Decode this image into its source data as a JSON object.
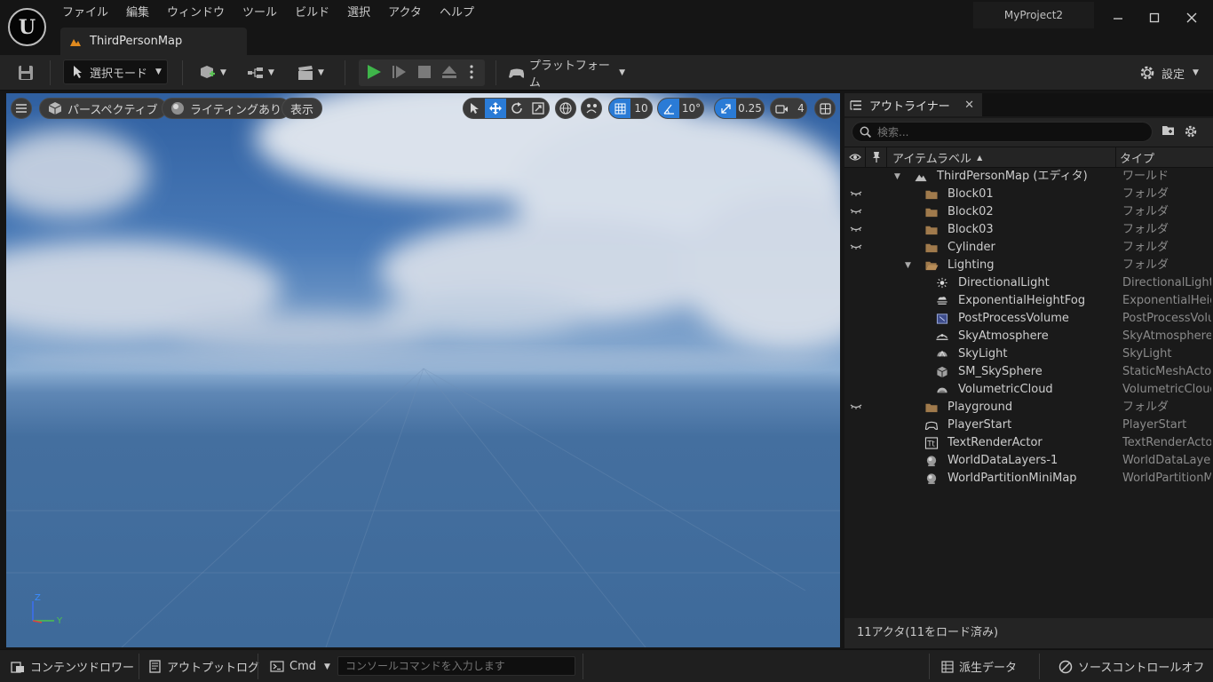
{
  "menu": {
    "items": [
      "ファイル",
      "編集",
      "ウィンドウ",
      "ツール",
      "ビルド",
      "選択",
      "アクタ",
      "ヘルプ"
    ]
  },
  "title_bar": {
    "document_tab": "ThirdPersonMap",
    "project_name": "MyProject2",
    "logo_letter": "U"
  },
  "toolbar": {
    "mode_label": "選択モード",
    "platform_label": "プラットフォーム",
    "settings_label": "設定"
  },
  "viewport": {
    "perspective_label": "パースペクティブ",
    "lighting_label": "ライティングあり",
    "show_label": "表示",
    "grid_snap_value": "10",
    "rotation_snap_value": "10°",
    "scale_snap_value": "0.25",
    "camera_speed_value": "4",
    "axis_z": "Z",
    "axis_y": "Y"
  },
  "outliner": {
    "tab_label": "アウトライナー",
    "search_placeholder": "検索...",
    "col_item_label": "アイテムラベル",
    "col_type": "タイプ",
    "status": "11アクタ(11をロード済み)",
    "rows": [
      {
        "label": "ThirdPersonMap (エディタ)",
        "type": "ワールド",
        "icon": "world-icon"
      },
      {
        "label": "Block01",
        "type": "フォルダ",
        "icon": "folder-icon"
      },
      {
        "label": "Block02",
        "type": "フォルダ",
        "icon": "folder-icon"
      },
      {
        "label": "Block03",
        "type": "フォルダ",
        "icon": "folder-icon"
      },
      {
        "label": "Cylinder",
        "type": "フォルダ",
        "icon": "folder-icon"
      },
      {
        "label": "Lighting",
        "type": "フォルダ",
        "icon": "folder-open-icon"
      },
      {
        "label": "DirectionalLight",
        "type": "DirectionalLight",
        "icon": "directional-light-icon"
      },
      {
        "label": "ExponentialHeightFog",
        "type": "ExponentialHeightFog",
        "icon": "fog-icon"
      },
      {
        "label": "PostProcessVolume",
        "type": "PostProcessVolume",
        "icon": "post-process-icon"
      },
      {
        "label": "SkyAtmosphere",
        "type": "SkyAtmosphere",
        "icon": "sky-atmosphere-icon"
      },
      {
        "label": "SkyLight",
        "type": "SkyLight",
        "icon": "sky-light-icon"
      },
      {
        "label": "SM_SkySphere",
        "type": "StaticMeshActor",
        "icon": "static-mesh-icon"
      },
      {
        "label": "VolumetricCloud",
        "type": "VolumetricCloud",
        "icon": "cloud-icon"
      },
      {
        "label": "Playground",
        "type": "フォルダ",
        "icon": "folder-icon"
      },
      {
        "label": "PlayerStart",
        "type": "PlayerStart",
        "icon": "player-start-icon"
      },
      {
        "label": "TextRenderActor",
        "type": "TextRenderActor",
        "icon": "text-render-icon"
      },
      {
        "label": "WorldDataLayers-1",
        "type": "WorldDataLayers",
        "icon": "sphere-icon"
      },
      {
        "label": "WorldPartitionMiniMap",
        "type": "WorldPartitionMiniMap",
        "icon": "sphere-icon"
      }
    ]
  },
  "status_bar": {
    "content_drawer": "コンテンツドロワー",
    "output_log": "アウトプットログ",
    "cmd_label": "Cmd",
    "console_placeholder": "コンソールコマンドを入力します",
    "derived_data": "派生データ",
    "source_control": "ソースコントロールオフ"
  },
  "colors": {
    "accent_blue": "#2a7bd6",
    "play_green": "#3fb54a",
    "folder_brown": "#a07a4c",
    "background": "#151515"
  }
}
